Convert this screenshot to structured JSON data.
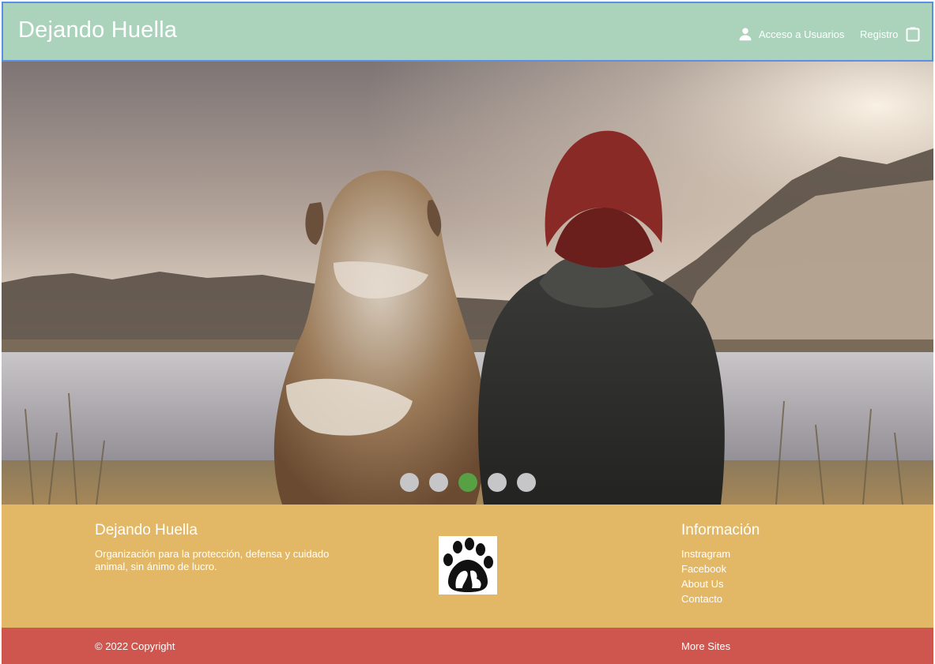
{
  "header": {
    "brand": "Dejando Huella",
    "nav": {
      "login_label": "Acceso a Usuarios",
      "register_label": "Registro"
    }
  },
  "carousel": {
    "slide_count": 5,
    "active_slide_index": 2
  },
  "footer": {
    "about": {
      "title": "Dejando Huella",
      "description": "Organización para la protección, defensa y cuidado animal, sin ánimo de lucro."
    },
    "info": {
      "title": "Información",
      "links": [
        "Instragram",
        "Facebook",
        "About Us",
        "Contacto"
      ]
    }
  },
  "bottom_bar": {
    "copyright": "© 2022 Copyright",
    "more_sites": "More Sites"
  },
  "colors": {
    "header_bg": "#abd3bc",
    "footer_bg": "#e2b766",
    "bottom_bar_bg": "#cf564f",
    "dot_active": "#57a043",
    "dot_inactive": "#c6c6c8"
  },
  "icons": {
    "login": "user-icon",
    "register": "clipboard-icon"
  }
}
